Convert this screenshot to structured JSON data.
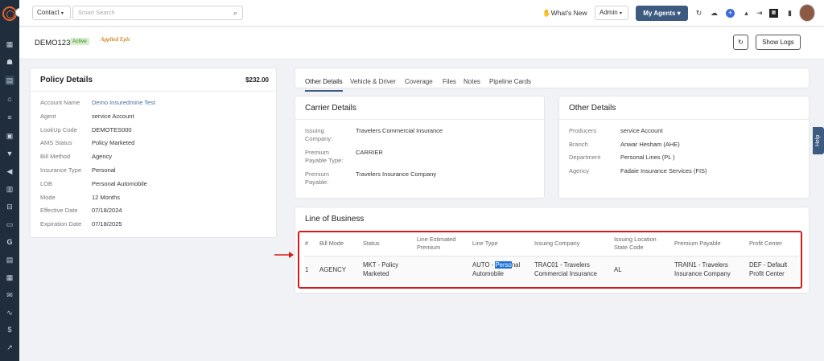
{
  "topbar": {
    "contact_select": "Contact",
    "search_placeholder": "Smart Search",
    "whats_new": "What's New",
    "admin_select": "Admin",
    "my_agents": "My Agents"
  },
  "header": {
    "account_id": "DEMO1234",
    "status_badge": "Active",
    "logo_text": "Applied Epic",
    "show_logs": "Show Logs"
  },
  "policy": {
    "title": "Policy Details",
    "amount": "$232.00",
    "fields": [
      {
        "label": "Account Name",
        "value": "Demo Insuredmine Test"
      },
      {
        "label": "Agent",
        "value": "service Account"
      },
      {
        "label": "LookUp Code",
        "value": "DEMOTES000"
      },
      {
        "label": "AMS Status",
        "value": "Policy Marketed"
      },
      {
        "label": "Bill Method",
        "value": "Agency"
      },
      {
        "label": "Insurance Type",
        "value": "Personal"
      },
      {
        "label": "LOB",
        "value": "Personal Automobile"
      },
      {
        "label": "Mode",
        "value": "12 Months"
      },
      {
        "label": "Effective Date",
        "value": "07/18/2024"
      },
      {
        "label": "Expiration Date",
        "value": "07/18/2025"
      }
    ]
  },
  "tabs": [
    "Other Details",
    "Vehicle & Driver",
    "Coverage",
    "Files",
    "Notes",
    "Pipeline Cards"
  ],
  "carrier": {
    "title": "Carrier Details",
    "fields": [
      {
        "label": "Issuing Company:",
        "value": "Travelers Commercial Insurance"
      },
      {
        "label": "Premium Payable Type:",
        "value": "CARRIER"
      },
      {
        "label": "Premium Payable:",
        "value": "Travelers Insurance Company"
      }
    ]
  },
  "other": {
    "title": "Other Details",
    "fields": [
      {
        "label": "Producers",
        "value": "service Account"
      },
      {
        "label": "Branch",
        "value": "Anwar Hesham (AHE)"
      },
      {
        "label": "Department",
        "value": "Personal Lines (PL )"
      },
      {
        "label": "Agency",
        "value": "Fadaie Insurance Services (FIS)"
      }
    ]
  },
  "lob": {
    "title": "Line of Business",
    "headers": [
      "#",
      "Bill Mode",
      "Status",
      "Line Estimated Premium",
      "Line Type",
      "Issuing Company",
      "Issuing Location State Code",
      "Premium Payable",
      "Profit Center"
    ],
    "row": {
      "num": "1",
      "bill_mode": "AGENCY",
      "status": "MKT - Policy Marketed",
      "premium": "",
      "line_type_a": "AUTO - ",
      "line_type_sel": "Perso",
      "line_type_b": "nal",
      "line_type_c": "Automobile",
      "issuing_company": "TRAC01 - Travelers Commercial Insurance",
      "state": "AL",
      "premium_payable": "TRAIN1 - Travelers Insurance Company",
      "profit_center": "DEF - Default Profit Center"
    }
  },
  "help": "Help",
  "colors": {
    "sidebar": "#1f2d3d",
    "accent": "#3d5a80",
    "brand": "#e8622c",
    "highlight_border": "#d7191c",
    "badge_bg": "#d4efc8",
    "selection": "#1a6fd6"
  }
}
